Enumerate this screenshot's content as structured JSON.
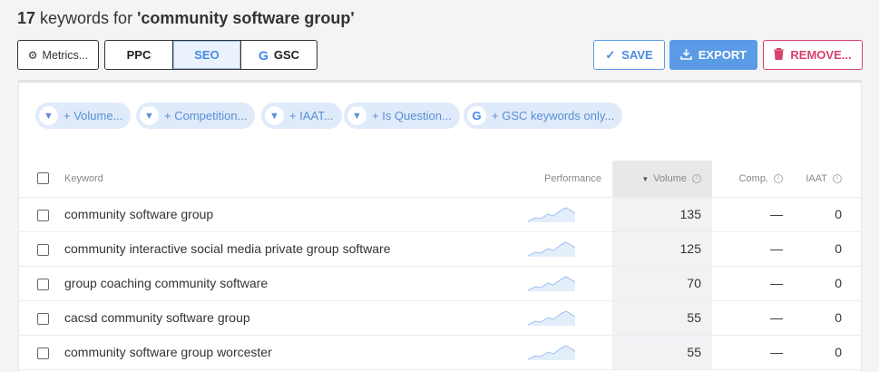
{
  "header": {
    "count": "17",
    "text": " keywords for ",
    "query": "'community software group'"
  },
  "toolbar": {
    "metrics_label": "Metrics...",
    "tabs": [
      "PPC",
      "SEO",
      "GSC"
    ],
    "active_tab": "SEO",
    "save_label": "SAVE",
    "export_label": "EXPORT",
    "remove_label": "REMOVE..."
  },
  "filters": [
    {
      "label": "+ Volume...",
      "icon": "filter-icon"
    },
    {
      "label": "+ Competition...",
      "icon": "filter-icon"
    },
    {
      "label": "+ IAAT...",
      "icon": "filter-icon"
    },
    {
      "label": "+ Is Question...",
      "icon": "filter-icon"
    },
    {
      "label": "+ GSC keywords only...",
      "icon": "google-icon"
    }
  ],
  "table": {
    "columns": {
      "keyword": "Keyword",
      "performance": "Performance",
      "volume": "Volume",
      "comp": "Comp.",
      "iaat": "IAAT"
    },
    "sort_column": "Volume",
    "rows": [
      {
        "keyword": "community software group",
        "volume": "135",
        "comp": "—",
        "iaat": "0"
      },
      {
        "keyword": "community interactive social media private group software",
        "volume": "125",
        "comp": "—",
        "iaat": "0"
      },
      {
        "keyword": "group coaching community software",
        "volume": "70",
        "comp": "—",
        "iaat": "0"
      },
      {
        "keyword": "cacsd community software group",
        "volume": "55",
        "comp": "—",
        "iaat": "0"
      },
      {
        "keyword": "community software group worcester",
        "volume": "55",
        "comp": "—",
        "iaat": "0"
      }
    ]
  },
  "colors": {
    "accent": "#5b9be6",
    "danger": "#d5426b",
    "chip_bg": "#dfeafa"
  }
}
